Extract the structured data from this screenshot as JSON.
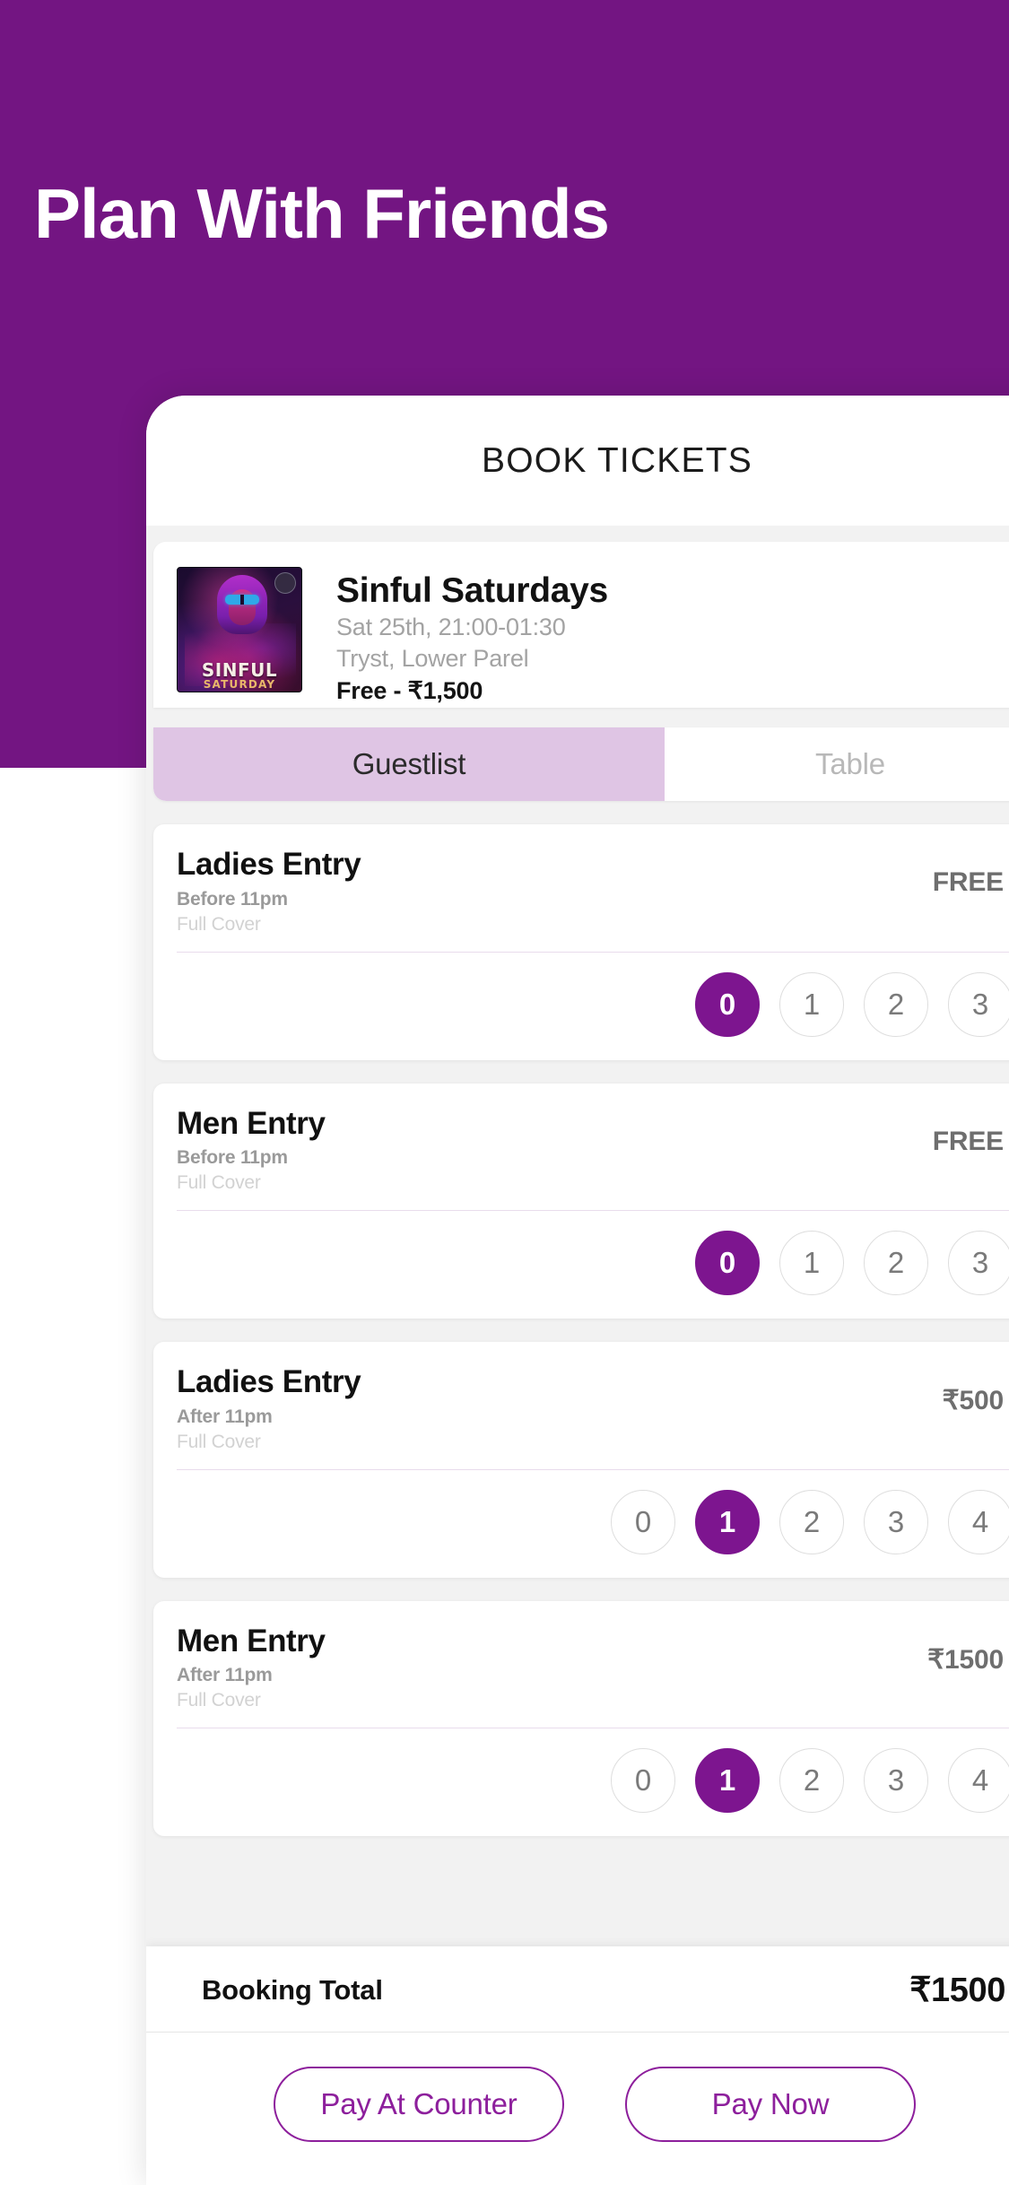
{
  "hero": {
    "title": "Plan With Friends",
    "background_color": "#731582"
  },
  "app": {
    "header_title": "BOOK TICKETS"
  },
  "event": {
    "name": "Sinful Saturdays",
    "datetime": "Sat 25th, 21:00-01:30",
    "venue": "Tryst, Lower Parel",
    "price_range": "Free - ₹1,500",
    "poster_title": "SINFUL",
    "poster_subtitle": "SATURDAY"
  },
  "tabs": [
    {
      "label": "Guestlist",
      "active": true
    },
    {
      "label": "Table",
      "active": false
    }
  ],
  "tickets": [
    {
      "name": "Ladies Entry",
      "timing": "Before 11pm",
      "cover": "Full Cover",
      "price": "FREE",
      "quantities": [
        "0",
        "1",
        "2",
        "3"
      ],
      "selected": 0
    },
    {
      "name": "Men Entry",
      "timing": "Before 11pm",
      "cover": "Full Cover",
      "price": "FREE",
      "quantities": [
        "0",
        "1",
        "2",
        "3"
      ],
      "selected": 0
    },
    {
      "name": "Ladies Entry",
      "timing": "After 11pm",
      "cover": "Full Cover",
      "price": "₹500",
      "quantities": [
        "0",
        "1",
        "2",
        "3",
        "4"
      ],
      "selected": 1
    },
    {
      "name": "Men Entry",
      "timing": "After  11pm",
      "cover": "Full Cover",
      "price": "₹1500",
      "quantities": [
        "0",
        "1",
        "2",
        "3",
        "4"
      ],
      "selected": 1
    }
  ],
  "footer": {
    "booking_total_label": "Booking Total",
    "booking_total_value": "₹1500",
    "pay_at_counter_label": "Pay At Counter",
    "pay_now_label": "Pay Now"
  },
  "colors": {
    "brand_purple": "#731582",
    "accent_purple": "#7d158f",
    "tab_active_bg": "#dfc5e4",
    "button_border": "#8d1f9c"
  }
}
